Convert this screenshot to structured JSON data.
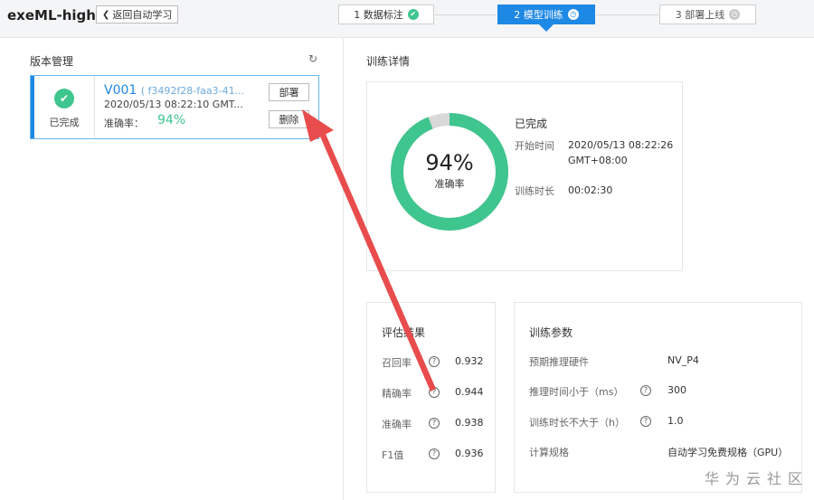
{
  "app": {
    "title": "exeML-high",
    "back_label": "返回自动学习"
  },
  "steps": [
    {
      "label": "1 数据标注",
      "icon": "check-circle-icon",
      "state": "done"
    },
    {
      "label": "2 模型训练",
      "icon": "clock-icon",
      "state": "active"
    },
    {
      "label": "3 部署上线",
      "icon": "clock-icon",
      "state": "pending"
    }
  ],
  "version_panel": {
    "title": "版本管理",
    "refresh_icon": "refresh-icon",
    "card": {
      "status": "已完成",
      "name": "V001",
      "hash": "( f3492f28-faa3-41...",
      "time": "2020/05/13 08:22:10 GMT...",
      "accuracy_label": "准确率：",
      "accuracy_value": "94%",
      "deploy_label": "部署",
      "delete_label": "删除"
    }
  },
  "training_detail": {
    "title": "训练详情",
    "donut": {
      "percent": 94,
      "value_text": "94%",
      "label": "准确率",
      "color": "#3fc58e",
      "track_color": "#d9d9d9"
    },
    "status": "已完成",
    "start_label": "开始时间",
    "start_value": "2020/05/13 08:22:26 GMT+08:00",
    "duration_label": "训练时长",
    "duration_value": "00:02:30"
  },
  "evaluation": {
    "title": "评估结果",
    "rows": [
      {
        "label": "召回率",
        "value": "0.932"
      },
      {
        "label": "精确率",
        "value": "0.944"
      },
      {
        "label": "准确率",
        "value": "0.938"
      },
      {
        "label": "F1值",
        "value": "0.936"
      }
    ]
  },
  "params": {
    "title": "训练参数",
    "rows": [
      {
        "label": "预期推理硬件",
        "value": "NV_P4",
        "help": false
      },
      {
        "label": "推理时间小于（ms）",
        "value": "300",
        "help": true
      },
      {
        "label": "训练时长不大于（h）",
        "value": "1.0",
        "help": true
      },
      {
        "label": "计算规格",
        "value": "自动学习免费规格（GPU）",
        "help": false
      }
    ]
  },
  "watermark": "华为云社区",
  "colors": {
    "primary": "#1e88e5",
    "success": "#3fc58e",
    "annotation": "#e84c4c"
  }
}
